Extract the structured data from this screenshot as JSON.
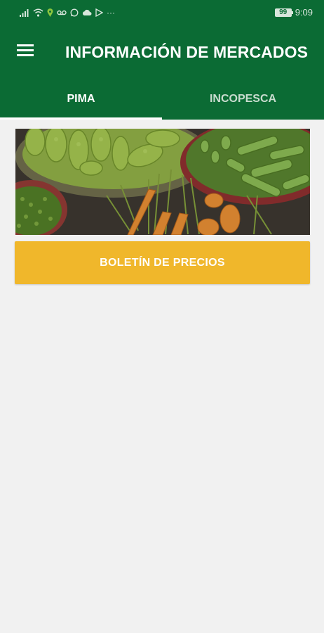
{
  "status_bar": {
    "battery": "99",
    "time": "9:09",
    "overflow": "···"
  },
  "app_bar": {
    "title": "INFORMACIÓN DE MERCADOS",
    "menu_icon": "hamburger-menu-icon"
  },
  "tabs": [
    {
      "label": "PIMA",
      "selected": true
    },
    {
      "label": "INCOPESCA",
      "selected": false
    }
  ],
  "banner": {
    "image": "vegetables-market-banner"
  },
  "main": {
    "bulletin_button_label": "BOLETÍN DE PRECIOS"
  },
  "colors": {
    "primary_green": "#0b6b34",
    "accent_yellow": "#f0b72b",
    "background": "#f1f1f1"
  }
}
